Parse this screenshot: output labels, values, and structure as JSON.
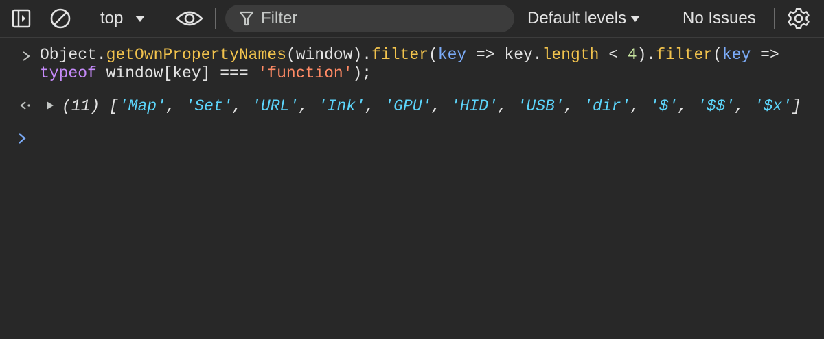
{
  "toolbar": {
    "context": "top",
    "filter_placeholder": "Filter",
    "levels": "Default levels",
    "issues": "No Issues"
  },
  "console": {
    "input_line1": {
      "obj": "Object",
      "dot1": ".",
      "m1": "getOwnPropertyNames",
      "p1": "(window).",
      "m2": "filter",
      "p2": "(",
      "k1": "key",
      "arrow1": " => key.",
      "m3": "length",
      "lt": " < ",
      "num": "4",
      "p3": ").",
      "m4": "filter",
      "p4": "(",
      "k2": "key",
      "arrow2": " =>"
    },
    "input_line2": {
      "kw": "typeof",
      "mid": " window[key] === ",
      "str": "'function'",
      "end": ");"
    },
    "result_count": "(11)",
    "result_open": "[",
    "result_items": [
      "'Map'",
      "'Set'",
      "'URL'",
      "'Ink'",
      "'GPU'",
      "'HID'",
      "'USB'",
      "'dir'",
      "'$'",
      "'$$'",
      "'$x'"
    ],
    "result_close": "]"
  }
}
